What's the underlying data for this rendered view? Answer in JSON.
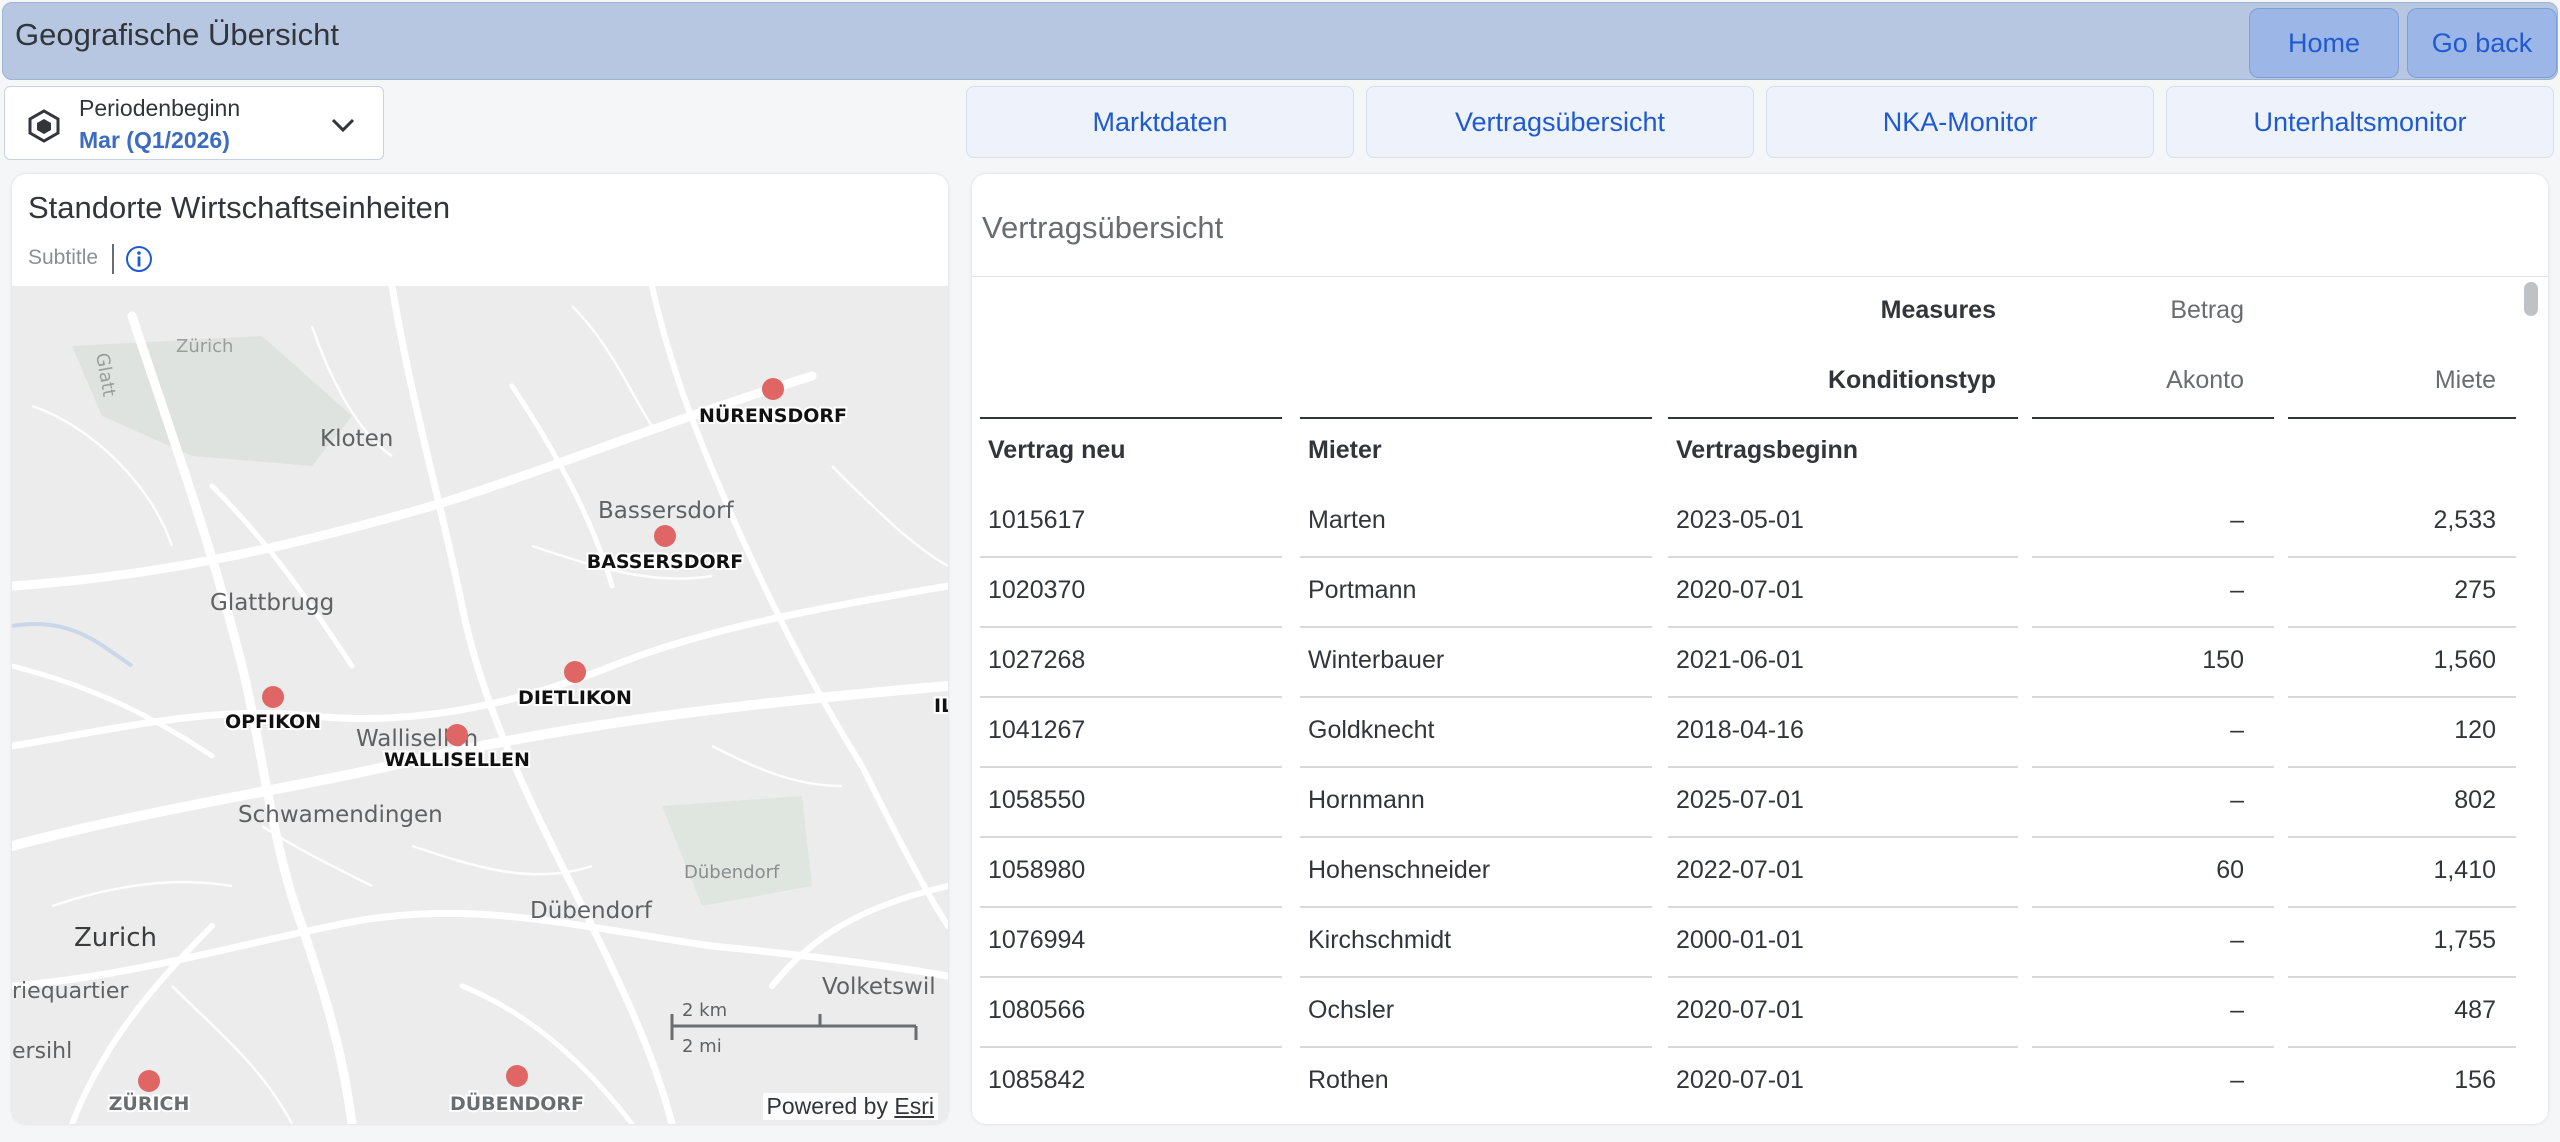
{
  "header": {
    "title": "Geografische Übersicht",
    "home_label": "Home",
    "back_label": "Go back"
  },
  "period": {
    "label": "Periodenbeginn",
    "value": "Mar (Q1/2026)"
  },
  "tabs": [
    "Marktdaten",
    "Vertragsübersicht",
    "NKA-Monitor",
    "Unterhaltsmonitor"
  ],
  "map_card": {
    "title": "Standorte Wirtschaftseinheiten",
    "subtitle": "Subtitle",
    "powered_by": "Powered by",
    "powered_by_link": "Esri",
    "scale_km": "2 km",
    "scale_mi": "2 mi",
    "place_labels": [
      "Glatt",
      "Zürich",
      "Kloten",
      "Bassersdorf",
      "Glattbrugg",
      "Wallisellen",
      "Schwamendingen",
      "Dübendorf",
      "Dübendorf",
      "Zurich",
      "riequartier",
      "ersihl",
      "Volketswil"
    ],
    "markers": [
      "NÜRENSDORF",
      "BASSERSDORF",
      "DIETLIKON",
      "OPFIKON",
      "WALLISELLEN",
      "ZÜRICH",
      "DÜBENDORF",
      "ILL"
    ]
  },
  "table_card": {
    "title": "Vertragsübersicht",
    "measures_label": "Measures",
    "betrag_label": "Betrag",
    "konditionstyp_label": "Konditionstyp",
    "akonto_label": "Akonto",
    "miete_label": "Miete",
    "columns": [
      "Vertrag neu",
      "Mieter",
      "Vertragsbeginn"
    ],
    "rows": [
      {
        "vertrag": "1015617",
        "mieter": "Marten",
        "beginn": "2023-05-01",
        "akonto": "–",
        "miete": "2,533"
      },
      {
        "vertrag": "1020370",
        "mieter": "Portmann",
        "beginn": "2020-07-01",
        "akonto": "–",
        "miete": "275"
      },
      {
        "vertrag": "1027268",
        "mieter": "Winterbauer",
        "beginn": "2021-06-01",
        "akonto": "150",
        "miete": "1,560"
      },
      {
        "vertrag": "1041267",
        "mieter": "Goldknecht",
        "beginn": "2018-04-16",
        "akonto": "–",
        "miete": "120"
      },
      {
        "vertrag": "1058550",
        "mieter": "Hornmann",
        "beginn": "2025-07-01",
        "akonto": "–",
        "miete": "802"
      },
      {
        "vertrag": "1058980",
        "mieter": "Hohenschneider",
        "beginn": "2022-07-01",
        "akonto": "60",
        "miete": "1,410"
      },
      {
        "vertrag": "1076994",
        "mieter": "Kirchschmidt",
        "beginn": "2000-01-01",
        "akonto": "–",
        "miete": "1,755"
      },
      {
        "vertrag": "1080566",
        "mieter": "Ochsler",
        "beginn": "2020-07-01",
        "akonto": "–",
        "miete": "487"
      },
      {
        "vertrag": "1085842",
        "mieter": "Rothen",
        "beginn": "2020-07-01",
        "akonto": "–",
        "miete": "156"
      }
    ]
  },
  "colors": {
    "header_bg": "#b7c7e1",
    "accent": "#1f5ad1",
    "marker": "#e06666"
  }
}
